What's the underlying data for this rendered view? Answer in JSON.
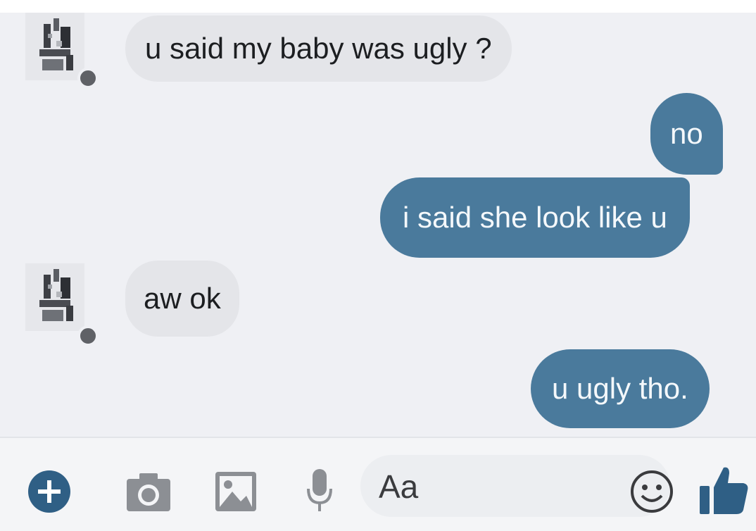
{
  "messages": [
    {
      "sender": "them",
      "text": "u said my baby was ugly ?"
    },
    {
      "sender": "me",
      "text": "no"
    },
    {
      "sender": "me",
      "text": "i said she look like u"
    },
    {
      "sender": "them",
      "text": "aw ok"
    },
    {
      "sender": "me",
      "text": "u ugly tho."
    }
  ],
  "composer": {
    "placeholder": "Aa",
    "icons": [
      "plus-icon",
      "camera-icon",
      "image-icon",
      "microphone-icon",
      "emoji-icon",
      "thumbs-up-icon"
    ]
  },
  "colors": {
    "outgoing_bubble": "#4a7a9c",
    "incoming_bubble": "#e4e5e9",
    "accent": "#2f5f85"
  }
}
